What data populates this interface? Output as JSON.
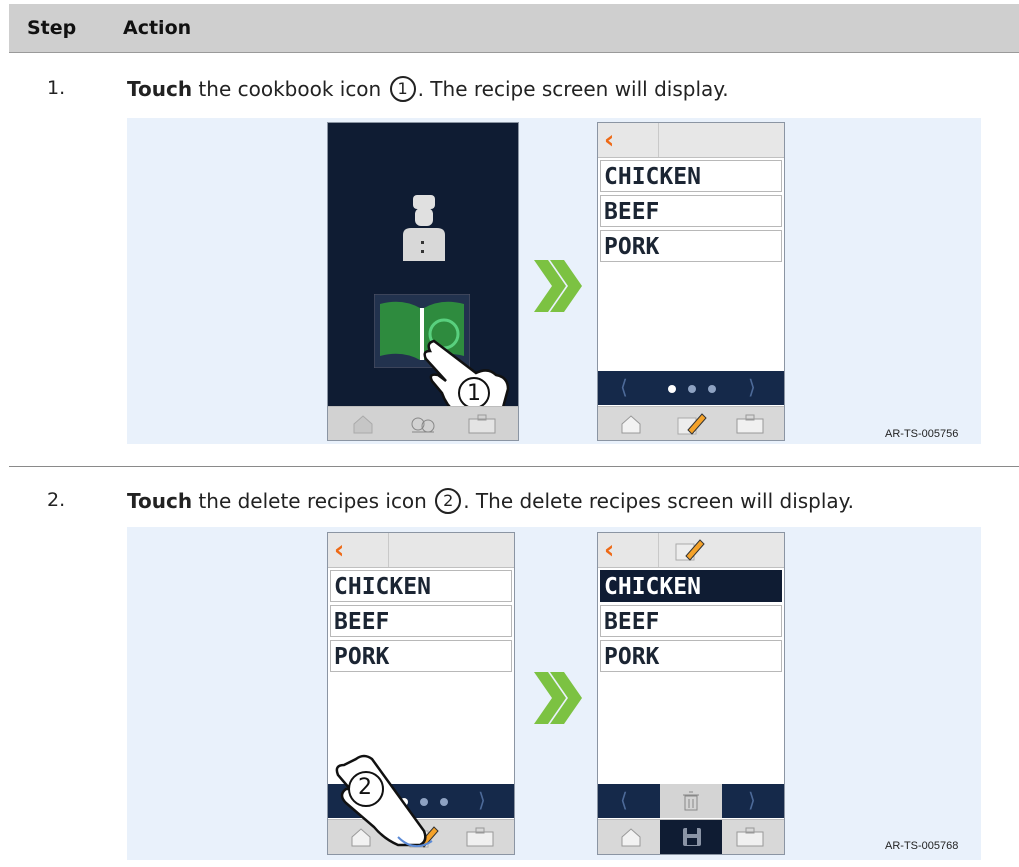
{
  "table": {
    "headers": {
      "step": "Step",
      "action": "Action"
    }
  },
  "steps": [
    {
      "number": "1.",
      "verb": "Touch",
      "text_before": " the cookbook icon ",
      "callout": "1",
      "text_after": ". The recipe screen will display.",
      "figure_ref": "AR-TS-005756",
      "hand_callout": "1"
    },
    {
      "number": "2.",
      "verb": "Touch",
      "text_before": " the delete recipes icon ",
      "callout": "2",
      "text_after": ". The delete recipes screen will display.",
      "figure_ref": "AR-TS-005768",
      "hand_callout": "2"
    }
  ],
  "recipes": [
    "CHICKEN",
    "BEEF",
    "PORK"
  ],
  "colors": {
    "accent_orange": "#ee6a17",
    "arrow_green": "#7cc242",
    "dark_navy": "#0f1c33",
    "book_green": "#2e8b3e",
    "figure_bg": "#e9f1fb"
  },
  "icons": {
    "back": "chevron-left-icon",
    "home": "home-icon",
    "edit": "pencil-edit-icon",
    "toolbox": "toolbox-icon",
    "trash": "trash-icon",
    "save": "save-icon",
    "chef": "chef-icon",
    "cookbook": "cookbook-icon",
    "food": "food-icon",
    "next": "double-chevron-right-icon",
    "touch": "pointing-hand-icon"
  },
  "screens": {
    "pager_dots_active_index": 0
  }
}
